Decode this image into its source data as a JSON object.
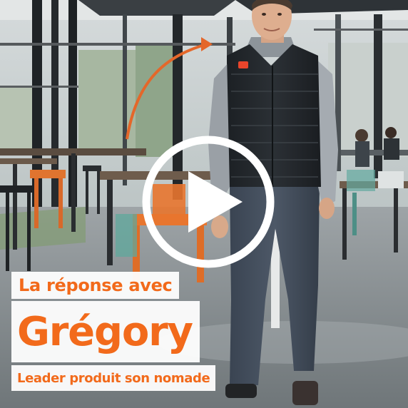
{
  "video": {
    "caption_intro": "La réponse avec",
    "caption_name": "Grégory",
    "caption_role": "Leader produit son nomade",
    "play_icon": "play-icon",
    "accent_color": "#f26a1b"
  }
}
